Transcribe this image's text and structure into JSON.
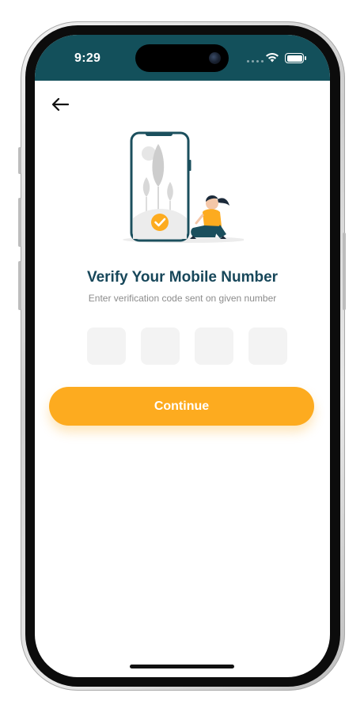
{
  "status_bar": {
    "time": "9:29",
    "background": "#13505b"
  },
  "nav": {
    "back_icon": "arrow-left-icon"
  },
  "illustration": {
    "icon": "phone-verification-illustration",
    "accent": "#fdab1f"
  },
  "verify": {
    "title": "Verify Your Mobile Number",
    "subtitle": "Enter verification code sent on given number"
  },
  "otp": {
    "digits": [
      "",
      "",
      "",
      ""
    ]
  },
  "actions": {
    "continue_label": "Continue",
    "continue_color": "#fdab1f"
  }
}
